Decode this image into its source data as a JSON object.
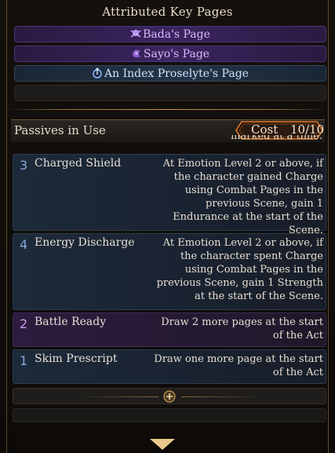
{
  "attributed_key_pages": {
    "title": "Attributed Key Pages",
    "pages": [
      {
        "label": "Bada's Page",
        "icon": "skull-crossbones-icon",
        "color": "#dcb6ff"
      },
      {
        "label": "Sayo's Page",
        "icon": "purple-emblem-icon",
        "color": "#dcb6ff"
      },
      {
        "label": "An Index Proselyte's Page",
        "icon": "index-emblem-icon",
        "color": "#cfe2ff"
      },
      {
        "label": "",
        "icon": "",
        "color": ""
      }
    ]
  },
  "passives": {
    "title": "Passives in Use",
    "cost_label": "Cost",
    "cost_value": "10/10",
    "cutoff_text": "marked at a time.",
    "items": [
      {
        "cost": "3",
        "name": "Charged Shield",
        "description": "At Emotion Level 2 or above, if the character gained Charge using Combat Pages in the previous Scene, gain 1 Endurance at the start of the Scene."
      },
      {
        "cost": "4",
        "name": "Energy Discharge",
        "description": "At Emotion Level 2 or above, if the character spent Charge using Combat Pages in the previous Scene, gain 1 Strength at the start of the Scene."
      },
      {
        "cost": "2",
        "name": "Battle Ready",
        "description": "Draw 2 more pages at the start of the Act"
      },
      {
        "cost": "1",
        "name": "Skim Prescript",
        "description": "Draw one more page at the start of the Act"
      }
    ],
    "add_icon": "plus-circle-icon"
  },
  "colors": {
    "accent_gold": "#c89a50",
    "cost_orange": "#e07a2a",
    "cost_number_blue": "#8aa7d8",
    "cost_number_purple": "#c79be8"
  }
}
